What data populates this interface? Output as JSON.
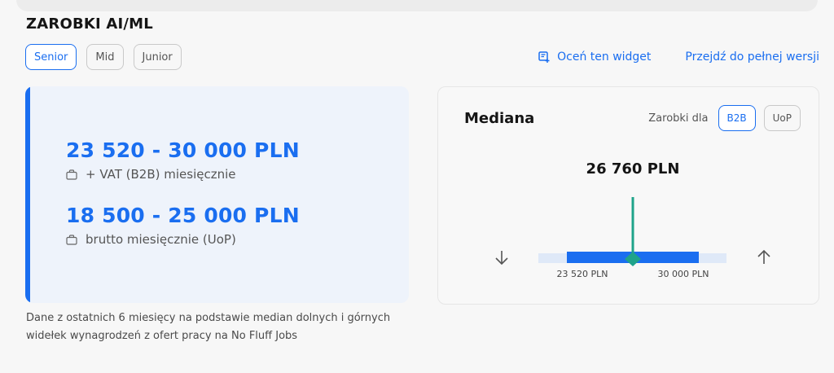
{
  "page": {
    "title": "ZAROBKI AI/ML"
  },
  "level_tabs": [
    {
      "label": "Senior",
      "active": true
    },
    {
      "label": "Mid",
      "active": false
    },
    {
      "label": "Junior",
      "active": false
    }
  ],
  "links": {
    "rate_widget": "Oceń ten widget",
    "full_version": "Przejdź do pełnej wersji"
  },
  "salaries": {
    "b2b": {
      "range": "23 520 - 30 000 PLN",
      "description": "+ VAT (B2B) miesięcznie"
    },
    "uop": {
      "range": "18 500 - 25 000 PLN",
      "description": "brutto miesięcznie (UoP)"
    }
  },
  "footnote": "Dane z ostatnich 6 miesięcy na podstawie median dolnych i górnych widełek wynagrodzeń z ofert pracy na No Fluff Jobs",
  "median": {
    "title": "Mediana",
    "contract_label": "Zarobki dla",
    "contract_options": [
      {
        "label": "B2B",
        "active": true
      },
      {
        "label": "UoP",
        "active": false
      }
    ],
    "value_label": "26 760 PLN",
    "lower_label": "23 520 PLN",
    "upper_label": "30 000 PLN",
    "range_min": 23520,
    "range_max": 30000,
    "median_value": 26760
  },
  "colors": {
    "accent": "#1a6ef0",
    "median_marker": "#1fa38a",
    "range_track": "#dfe9f8"
  },
  "icons": {
    "rate": "rate-widget-icon",
    "bag": "briefcase-icon",
    "down": "arrow-down-icon",
    "up": "arrow-up-icon"
  }
}
